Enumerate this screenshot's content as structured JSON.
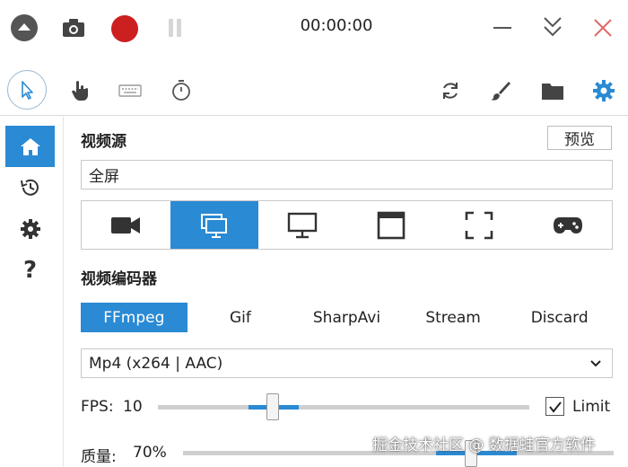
{
  "topbar": {
    "timer": "00:00:00"
  },
  "toolbar": {
    "left_icons": [
      "pointer-icon",
      "hand-icon",
      "keyboard-icon",
      "stopwatch-icon"
    ],
    "right_icons": [
      "refresh-icon",
      "brush-icon",
      "folder-icon",
      "settings-icon"
    ]
  },
  "sidebar": {
    "items": [
      "home-icon",
      "history-icon",
      "settings-icon",
      "help-icon"
    ],
    "help_label": "?"
  },
  "video_source": {
    "label": "视频源",
    "preview_button": "预览",
    "value": "全屏",
    "types": [
      "camera-icon",
      "screen-icon",
      "monitor-icon",
      "window-icon",
      "region-icon",
      "gamepad-icon"
    ],
    "selected_type_index": 1
  },
  "encoder": {
    "label": "视频编码器",
    "options": [
      "FFmpeg",
      "Gif",
      "SharpAvi",
      "Stream",
      "Discard"
    ],
    "selected": "FFmpeg",
    "format": "Mp4 (x264 | AAC)"
  },
  "fps": {
    "label": "FPS:",
    "value": "10",
    "limit_label": "Limit",
    "limit_checked": true
  },
  "quality": {
    "label": "质量:",
    "value": "70%"
  },
  "watermark": "掘金技术社区 @ 数据蛙官方软件",
  "colors": {
    "accent": "#2a8ad4",
    "record": "#cc1f1f"
  }
}
